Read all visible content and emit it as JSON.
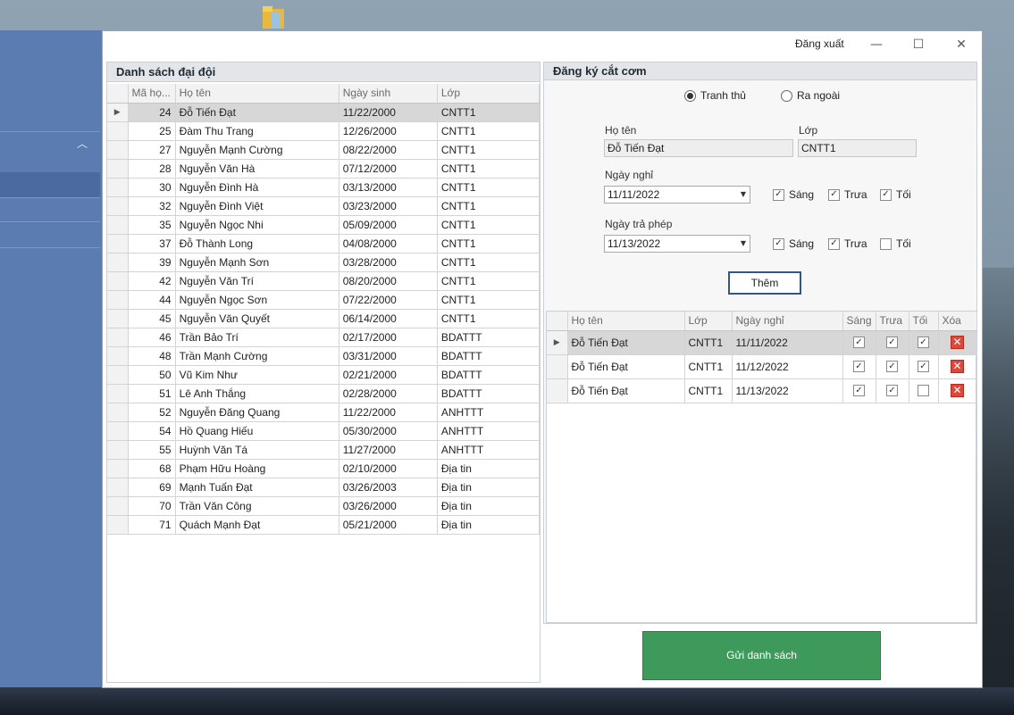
{
  "window": {
    "logout_label": "Đăng xuất",
    "minimize_icon": "minimize-icon",
    "maximize_icon": "maximize-icon",
    "close_icon": "close-icon"
  },
  "roster": {
    "title": "Danh sách đại đội",
    "columns": [
      "Mã họ...",
      "Họ tên",
      "Ngày sinh",
      "Lớp"
    ],
    "selected_index": 0,
    "rows": [
      {
        "id": "24",
        "name": "Đỗ Tiến Đạt",
        "dob": "11/22/2000",
        "class": "CNTT1"
      },
      {
        "id": "25",
        "name": "Đàm Thu Trang",
        "dob": "12/26/2000",
        "class": "CNTT1"
      },
      {
        "id": "27",
        "name": "Nguyễn Mạnh Cường",
        "dob": "08/22/2000",
        "class": "CNTT1"
      },
      {
        "id": "28",
        "name": "Nguyễn Văn Hà",
        "dob": "07/12/2000",
        "class": "CNTT1"
      },
      {
        "id": "30",
        "name": "Nguyễn Đình Hà",
        "dob": "03/13/2000",
        "class": "CNTT1"
      },
      {
        "id": "32",
        "name": "Nguyễn Đình Việt",
        "dob": "03/23/2000",
        "class": "CNTT1"
      },
      {
        "id": "35",
        "name": "Nguyễn Ngọc Nhi",
        "dob": "05/09/2000",
        "class": "CNTT1"
      },
      {
        "id": "37",
        "name": "Đỗ Thành Long",
        "dob": "04/08/2000",
        "class": "CNTT1"
      },
      {
        "id": "39",
        "name": "Nguyễn Mạnh Sơn",
        "dob": "03/28/2000",
        "class": "CNTT1"
      },
      {
        "id": "42",
        "name": "Nguyễn Văn Trí",
        "dob": "08/20/2000",
        "class": "CNTT1"
      },
      {
        "id": "44",
        "name": "Nguyễn Ngọc Sơn",
        "dob": "07/22/2000",
        "class": "CNTT1"
      },
      {
        "id": "45",
        "name": "Nguyễn Văn Quyết",
        "dob": "06/14/2000",
        "class": "CNTT1"
      },
      {
        "id": "46",
        "name": "Trần Bảo Trí",
        "dob": "02/17/2000",
        "class": "BDATTT"
      },
      {
        "id": "48",
        "name": "Trần Mạnh Cường",
        "dob": "03/31/2000",
        "class": "BDATTT"
      },
      {
        "id": "50",
        "name": "Vũ Kim Như",
        "dob": "02/21/2000",
        "class": "BDATTT"
      },
      {
        "id": "51",
        "name": "Lê Anh Thắng",
        "dob": "02/28/2000",
        "class": "BDATTT"
      },
      {
        "id": "52",
        "name": "Nguyễn Đăng Quang",
        "dob": "11/22/2000",
        "class": "ANHTTT"
      },
      {
        "id": "54",
        "name": "Hồ Quang Hiếu",
        "dob": "05/30/2000",
        "class": "ANHTTT"
      },
      {
        "id": "55",
        "name": "Huỳnh Văn Tá",
        "dob": "11/27/2000",
        "class": "ANHTTT"
      },
      {
        "id": "68",
        "name": "Phạm Hữu Hoàng",
        "dob": "02/10/2000",
        "class": "Địa tin"
      },
      {
        "id": "69",
        "name": "Mạnh Tuấn Đạt",
        "dob": "03/26/2003",
        "class": "Địa tin"
      },
      {
        "id": "70",
        "name": "Trần Văn Công",
        "dob": "03/26/2000",
        "class": "Địa tin"
      },
      {
        "id": "71",
        "name": "Quách Mạnh Đạt",
        "dob": "05/21/2000",
        "class": "Địa tin"
      }
    ]
  },
  "form": {
    "title": "Đăng ký cắt cơm",
    "radio_options": [
      {
        "label": "Tranh thủ",
        "checked": true
      },
      {
        "label": "Ra ngoài",
        "checked": false
      }
    ],
    "name_label": "Họ tên",
    "name_value": "Đỗ Tiến Đạt",
    "class_label": "Lớp",
    "class_value": "CNTT1",
    "leave_date_label": "Ngày nghỉ",
    "leave_date_value": "11/11/2022",
    "leave_meals": [
      {
        "label": "Sáng",
        "checked": true
      },
      {
        "label": "Trưa",
        "checked": true
      },
      {
        "label": "Tối",
        "checked": true
      }
    ],
    "return_date_label": "Ngày trả phép",
    "return_date_value": "11/13/2022",
    "return_meals": [
      {
        "label": "Sáng",
        "checked": true
      },
      {
        "label": "Trưa",
        "checked": true
      },
      {
        "label": "Tối",
        "checked": false
      }
    ],
    "add_label": "Thêm"
  },
  "registrations": {
    "columns": [
      "Họ tên",
      "Lớp",
      "Ngày nghỉ",
      "Sáng",
      "Trưa",
      "Tối",
      "Xóa"
    ],
    "rows": [
      {
        "name": "Đỗ Tiến Đạt",
        "class": "CNTT1",
        "date": "11/11/2022",
        "sang": true,
        "trua": true,
        "toi": true
      },
      {
        "name": "Đỗ Tiến Đạt",
        "class": "CNTT1",
        "date": "11/12/2022",
        "sang": true,
        "trua": true,
        "toi": true
      },
      {
        "name": "Đỗ Tiến Đạt",
        "class": "CNTT1",
        "date": "11/13/2022",
        "sang": true,
        "trua": true,
        "toi": false
      }
    ]
  },
  "send_label": "Gửi danh sách",
  "colors": {
    "send_button": "#3e9a5a",
    "sidebar": "#5b7cb1",
    "delete_icon": "#e0473b"
  }
}
